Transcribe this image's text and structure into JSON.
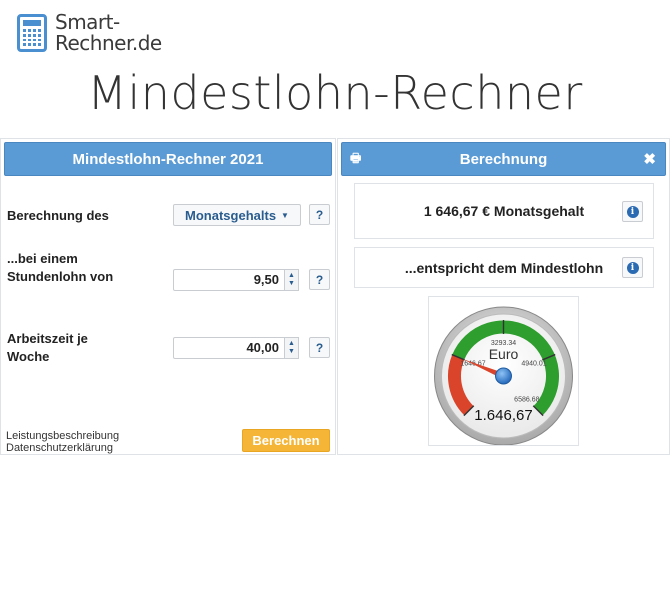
{
  "logo": {
    "line1": "Smart-",
    "line2": "Rechner.de"
  },
  "page_title": "Mindestlohn-Rechner",
  "left_panel": {
    "header": "Mindestlohn-Rechner 2021",
    "calc_type": {
      "label": "Berechnung des",
      "selected": "Monatsgehalts"
    },
    "hourly_wage": {
      "label_line1": "...bei einem",
      "label_line2": "Stundenlohn von",
      "value": "9,50"
    },
    "working_time": {
      "label_line1": "Arbeitszeit je",
      "label_line2": "Woche",
      "value": "40,00"
    },
    "help_label": "?",
    "links": [
      "Leistungsbeschreibung",
      "Datenschutzerklärung"
    ],
    "calc_button": "Berechnen"
  },
  "right_panel": {
    "header": "Berechnung",
    "result_main": "1 646,67 € Monatsgehalt",
    "result_sub": "...entspricht dem Mindestlohn",
    "info_label": "i",
    "gauge": {
      "unit": "Euro",
      "value_label": "1.646,67",
      "value": 1646.67,
      "min": 0,
      "max": 6586.68,
      "tick_labels": [
        "1646.67",
        "3293.34",
        "4940.01",
        "6586.68"
      ],
      "colors": {
        "red": "#d9442a",
        "green": "#2e9e2e"
      }
    }
  },
  "colors": {
    "header_bg": "#5b9bd5",
    "button_orange": "#f5b537",
    "link_blue": "#2a5d8f"
  }
}
